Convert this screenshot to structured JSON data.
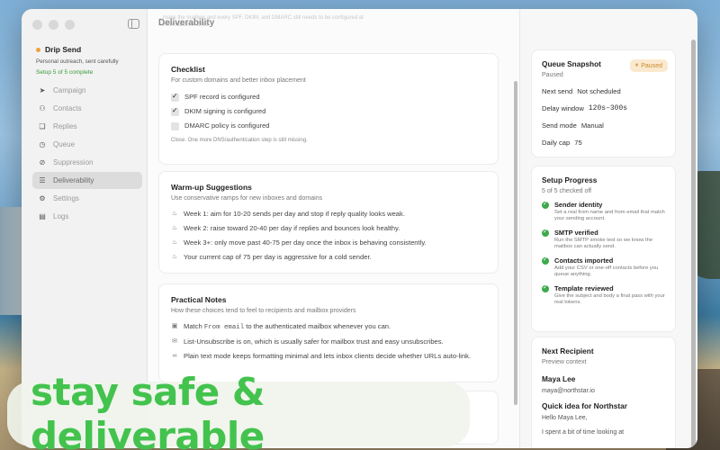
{
  "app": {
    "name": "Drip Send",
    "subtitle": "Personal outreach, sent carefully",
    "setup_status": "Setup 5 of 5 complete"
  },
  "sidebar": {
    "items": [
      {
        "label": "Campaign",
        "icon": "send-icon"
      },
      {
        "label": "Contacts",
        "icon": "people-icon"
      },
      {
        "label": "Replies",
        "icon": "chat-bubbles-icon"
      },
      {
        "label": "Queue",
        "icon": "clock-icon"
      },
      {
        "label": "Suppression",
        "icon": "block-icon"
      },
      {
        "label": "Deliverability",
        "icon": "list-check-icon",
        "active": true
      },
      {
        "label": "Settings",
        "icon": "gear-icon"
      },
      {
        "label": "Logs",
        "icon": "logs-icon"
      }
    ]
  },
  "main": {
    "title": "Deliverability",
    "faded_line_1": "...make the mailbox and every SPF, DKIM, and DMARC still needs to be configured at",
    "faded_line_2": "...information in DNS.",
    "checklist": {
      "title": "Checklist",
      "subtitle": "For custom domains and better inbox placement",
      "items": [
        {
          "label": "SPF record is configured",
          "checked": true
        },
        {
          "label": "DKIM signing is configured",
          "checked": true
        },
        {
          "label": "DMARC policy is configured",
          "checked": false
        }
      ],
      "note": "Close. One more DNS/authentication step is still missing."
    },
    "warmup": {
      "title": "Warm-up Suggestions",
      "subtitle": "Use conservative ramps for new inboxes and domains",
      "items": [
        "Week 1: aim for 10-20 sends per day and stop if reply quality looks weak.",
        "Week 2: raise toward 20-40 per day if replies and bounces look healthy.",
        "Week 3+: only move past 40-75 per day once the inbox is behaving consistently.",
        "Your current cap of 75 per day is aggressive for a cold sender."
      ]
    },
    "notes": {
      "title": "Practical Notes",
      "subtitle": "How these choices tend to feel to recipients and mailbox providers",
      "note1_pre": "Match",
      "note1_code": "From email",
      "note1_post": "to the authenticated mailbox whenever you can.",
      "note2": "List-Unsubscribe is on, which is usually safer for mailbox trust and easy unsubscribes.",
      "note3": "Plain text mode keeps formatting minimal and lets inbox clients decide whether URLs auto-link."
    }
  },
  "queue": {
    "title": "Queue Snapshot",
    "status": "Paused",
    "badge": "Paused",
    "next_send_label": "Next send",
    "next_send_value": "Not scheduled",
    "delay_label": "Delay window",
    "delay_value": "120s–300s",
    "mode_label": "Send mode",
    "mode_value": "Manual",
    "cap_label": "Daily cap",
    "cap_value": "75"
  },
  "setup": {
    "title": "Setup Progress",
    "subtitle": "5 of 5 checked off",
    "steps": [
      {
        "title": "Sender identity",
        "desc": "Set a real from name and from email that match your sending account."
      },
      {
        "title": "SMTP verified",
        "desc": "Run the SMTP smoke test so we know the mailbox can actually send."
      },
      {
        "title": "Contacts imported",
        "desc": "Add your CSV or one-off contacts before you queue anything."
      },
      {
        "title": "Template reviewed",
        "desc": "Give the subject and body a final pass with your real tokens."
      }
    ]
  },
  "recipient": {
    "title": "Next Recipient",
    "subtitle": "Preview context",
    "name": "Maya Lee",
    "email": "maya@northstar.io",
    "subject": "Quick idea for Northstar",
    "greeting": "Hello Maya Lee,",
    "body": "I spent a bit of time looking at"
  },
  "banner": {
    "text": "stay safe & deliverable"
  },
  "colors": {
    "accent_green": "#43c34e",
    "status_orange": "#f0a040",
    "paused_badge_bg": "#fbe9cf"
  }
}
